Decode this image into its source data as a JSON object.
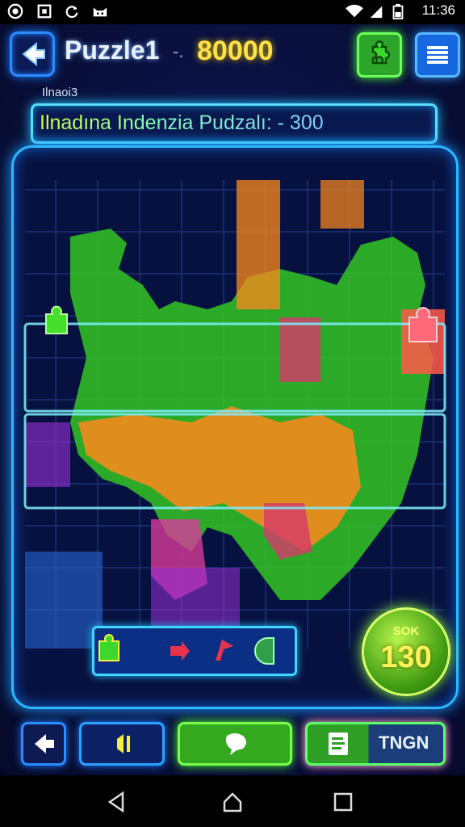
{
  "status_bar": {
    "time": "11:36",
    "icons": [
      "record-icon",
      "screenshot-icon",
      "sync-icon",
      "cat-icon",
      "wifi-icon",
      "signal-icon",
      "battery-icon"
    ]
  },
  "header": {
    "title": "Puzzle1",
    "separator": "-.",
    "score": "80000"
  },
  "level_label": "Ilnaoi3",
  "banner": {
    "text": "Ilnadına Indenzia Pudzalı: - 300"
  },
  "board": {
    "pieces_colors": [
      "#35e02a",
      "#ff8a1c",
      "#d63a6a",
      "#2b6de0",
      "#9a2fd6",
      "#1fa84a"
    ],
    "tray_icons": [
      "puzzle-piece-icon",
      "arrow-right-icon",
      "flag-icon",
      "cursor-icon"
    ]
  },
  "timer": {
    "label": "SOK",
    "value": "130"
  },
  "bottom_bar": {
    "tngn_label": "TNGN"
  },
  "nav_bar": {
    "icons": [
      "back-triangle-icon",
      "home-icon",
      "recents-icon"
    ]
  },
  "colors": {
    "background": "#070a26",
    "neon_blue": "#2bb8ff",
    "neon_green": "#4cff3a",
    "score_yellow": "#ffe14a"
  }
}
